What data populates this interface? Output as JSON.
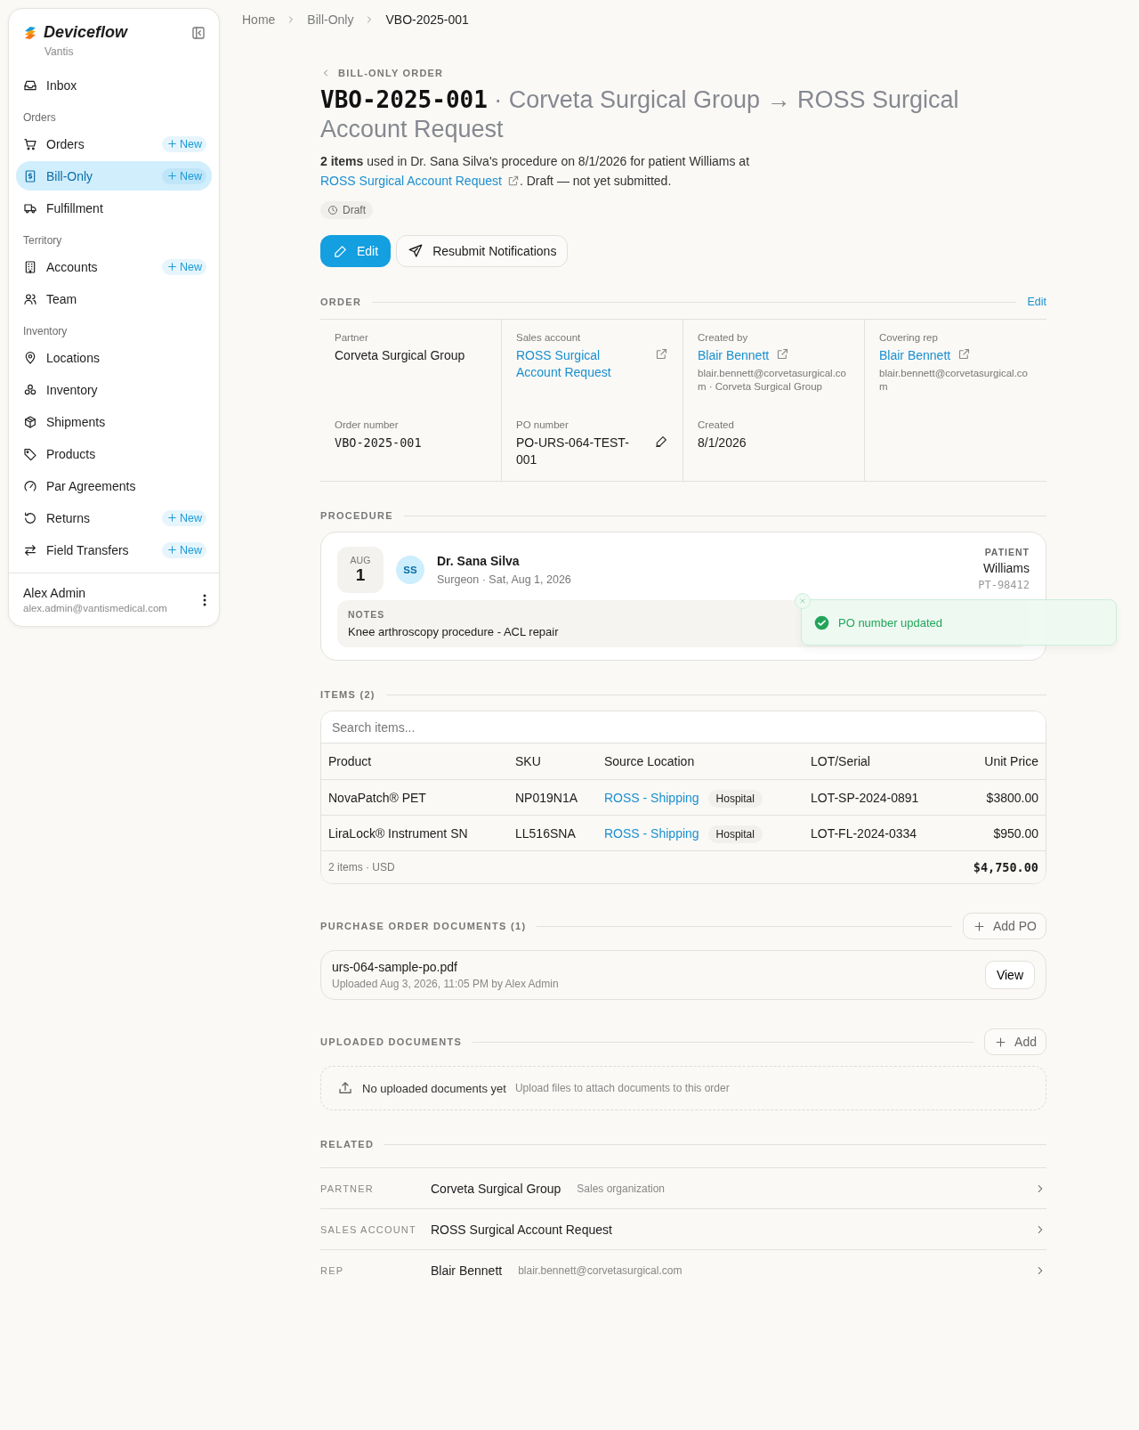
{
  "sidebar": {
    "brand": "Deviceflow",
    "org": "Vantis",
    "groups": [
      {
        "items": [
          {
            "label": "Inbox",
            "selected": false
          }
        ]
      },
      {
        "title": "Orders",
        "items": [
          {
            "label": "Orders",
            "selected": false,
            "action": "New"
          },
          {
            "label": "Bill-Only",
            "selected": true,
            "action": "New"
          },
          {
            "label": "Fulfillment",
            "selected": false
          }
        ]
      },
      {
        "title": "Territory",
        "items": [
          {
            "label": "Accounts",
            "selected": false,
            "action": "New"
          },
          {
            "label": "Team",
            "selected": false
          }
        ]
      },
      {
        "title": "Inventory",
        "items": [
          {
            "label": "Locations",
            "selected": false
          },
          {
            "label": "Inventory",
            "selected": false
          },
          {
            "label": "Shipments",
            "selected": false
          },
          {
            "label": "Products",
            "selected": false
          },
          {
            "label": "Par Agreements",
            "selected": false
          },
          {
            "label": "Returns",
            "selected": false,
            "action": "New"
          },
          {
            "label": "Field Transfers",
            "selected": false,
            "action": "New"
          }
        ]
      }
    ],
    "user": {
      "name": "Alex Admin",
      "email": "alex.admin@vantismedical.com"
    }
  },
  "breadcrumb": [
    "Home",
    "Bill-Only",
    "VBO-2025-001"
  ],
  "header": {
    "back_label": "BILL-ONLY ORDER",
    "order_id": "VBO-2025-001",
    "title": "· Corveta Surgical Group → ROSS Surgical Account Request",
    "summary_before": "**2 items** used in Dr. Sana Silva's procedure on 8/1/2026 for patient Williams at",
    "summary_link": "ROSS Surgical Account Request",
    "summary_after": ". Draft — not yet submitted.",
    "status": "Draft",
    "buttons": [
      {
        "label": "Edit",
        "kind": "primary"
      },
      {
        "label": "Resubmit Notifications",
        "kind": "secondary"
      }
    ]
  },
  "order": {
    "title": "ORDER",
    "action": "Edit",
    "fields": [
      {
        "label": "Partner",
        "value": "Corveta Surgical Group",
        "kind": "text"
      },
      {
        "label": "Sales account",
        "value": "ROSS Surgical Account Request",
        "kind": "link"
      },
      {
        "label": "Created by",
        "value": "Blair Bennett",
        "kind": "person",
        "detail": "blair.bennett@corvetasurgical.com · Corveta Surgical Group"
      },
      {
        "label": "Covering rep",
        "value": "Blair Bennett",
        "kind": "person",
        "detail": "blair.bennett@corvetasurgical.com"
      },
      {
        "label": "Order number",
        "value": "VBO-2025-001",
        "kind": "mono"
      },
      {
        "label": "PO number",
        "value": "PO-URS-064-TEST-001",
        "kind": "editable"
      },
      {
        "label": "Created",
        "value": "8/1/2026",
        "kind": "text"
      }
    ]
  },
  "procedure": {
    "title": "PROCEDURE",
    "month": "AUG",
    "day": "1",
    "initials": "SS",
    "surgeon": "Dr. Sana Silva",
    "subtitle": "Surgeon · Sat, Aug 1, 2026",
    "patient_label": "PATIENT",
    "patient": "Williams",
    "patient_id": "PT-98412",
    "notes_label": "NOTES",
    "notes": "Knee arthroscopy procedure - ACL repair"
  },
  "toast": {
    "message": "PO number updated",
    "kind": "success"
  },
  "items": {
    "title": "ITEMS (2)",
    "search": {
      "placeholder": "Search items..."
    },
    "columns": [
      "Product",
      "SKU",
      "Source Location",
      "LOT/Serial",
      "Unit Price"
    ],
    "rows": [
      {
        "product": "NovaPatch® PET",
        "sku": "NP019N1A",
        "location": "ROSS - Shipping",
        "location_type": "Hospital",
        "lot": "LOT-SP-2024-0891",
        "price": "$3800.00"
      },
      {
        "product": "LiraLock® Instrument SN",
        "sku": "LL516SNA",
        "location": "ROSS - Shipping",
        "location_type": "Hospital",
        "lot": "LOT-FL-2024-0334",
        "price": "$950.00"
      }
    ],
    "footer": "2 items · USD",
    "total": "$4,750.00"
  },
  "po_documents": {
    "title": "PURCHASE ORDER DOCUMENTS (1)",
    "action": "Add PO",
    "documents": [
      {
        "name": "urs-064-sample-po.pdf",
        "meta": "Uploaded Aug 3, 2026, 11:05 PM by Alex Admin",
        "action": "View"
      }
    ]
  },
  "uploaded_documents": {
    "title": "UPLOADED DOCUMENTS",
    "action": "Add",
    "empty_title": "No uploaded documents yet",
    "empty_text": "Upload files to attach documents to this order"
  },
  "related": {
    "title": "RELATED",
    "rows": [
      {
        "label": "PARTNER",
        "value": "Corveta Surgical Group",
        "detail": "Sales organization"
      },
      {
        "label": "SALES ACCOUNT",
        "value": "ROSS Surgical Account Request"
      },
      {
        "label": "REP",
        "value": "Blair Bennett",
        "detail": "blair.bennett@corvetasurgical.com"
      }
    ]
  }
}
